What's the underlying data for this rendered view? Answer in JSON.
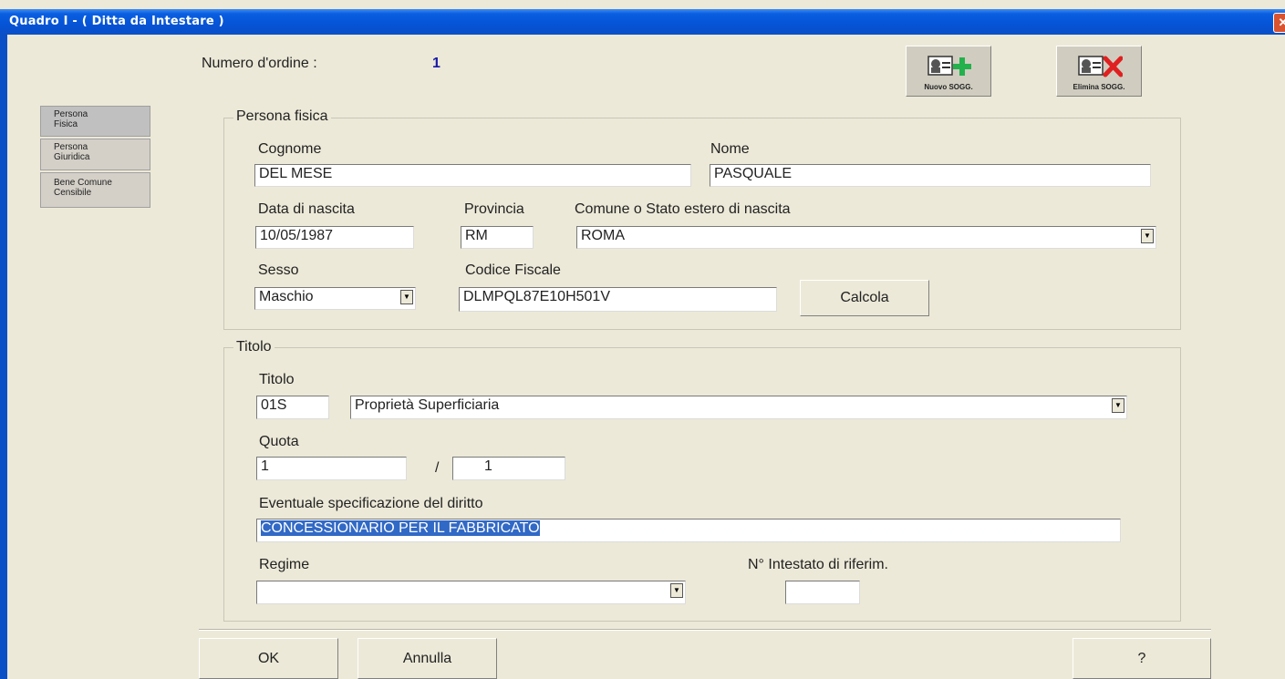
{
  "window": {
    "title": "Quadro I - ( Ditta da Intestare )",
    "close_glyph": "✕"
  },
  "header": {
    "numero_label": "Numero d'ordine :",
    "numero_value": "1"
  },
  "toolbar": {
    "nuovo_label": "Nuovo SOGG.",
    "elimina_label": "Elimina SOGG."
  },
  "tabs": [
    {
      "line1": "Persona",
      "line2": "Fisica"
    },
    {
      "line1": "Persona",
      "line2": "Giuridica"
    },
    {
      "line1": "Bene Comune",
      "line2": "Censibile"
    }
  ],
  "persona": {
    "group_title": "Persona fisica",
    "cognome_label": "Cognome",
    "cognome_value": "DEL MESE",
    "nome_label": "Nome",
    "nome_value": "PASQUALE",
    "data_label": "Data di nascita",
    "data_value": "10/05/1987",
    "provincia_label": "Provincia",
    "provincia_value": "RM",
    "comune_label": "Comune o Stato estero di nascita",
    "comune_value": "ROMA",
    "sesso_label": "Sesso",
    "sesso_value": "Maschio",
    "cf_label": "Codice Fiscale",
    "cf_value": "DLMPQL87E10H501V",
    "calcola_label": "Calcola"
  },
  "titolo": {
    "group_title": "Titolo",
    "titolo_label": "Titolo",
    "titolo_code": "01S",
    "titolo_value": "Proprietà Superficiaria",
    "quota_label": "Quota",
    "quota_num": "1",
    "quota_sep": "/",
    "quota_den": "1",
    "spec_label": "Eventuale specificazione del diritto",
    "spec_value": "CONCESSIONARIO PER IL FABBRICATO",
    "regime_label": "Regime",
    "regime_value": "",
    "intestato_label": "N° Intestato di riferim.",
    "intestato_value": ""
  },
  "footer": {
    "ok_label": "OK",
    "annulla_label": "Annulla",
    "help_label": "?"
  },
  "colors": {
    "titlebar": "#0553d6",
    "window_bg": "#ece9d8",
    "selection": "#3169c6",
    "numero_value": "#1a1aa8"
  }
}
